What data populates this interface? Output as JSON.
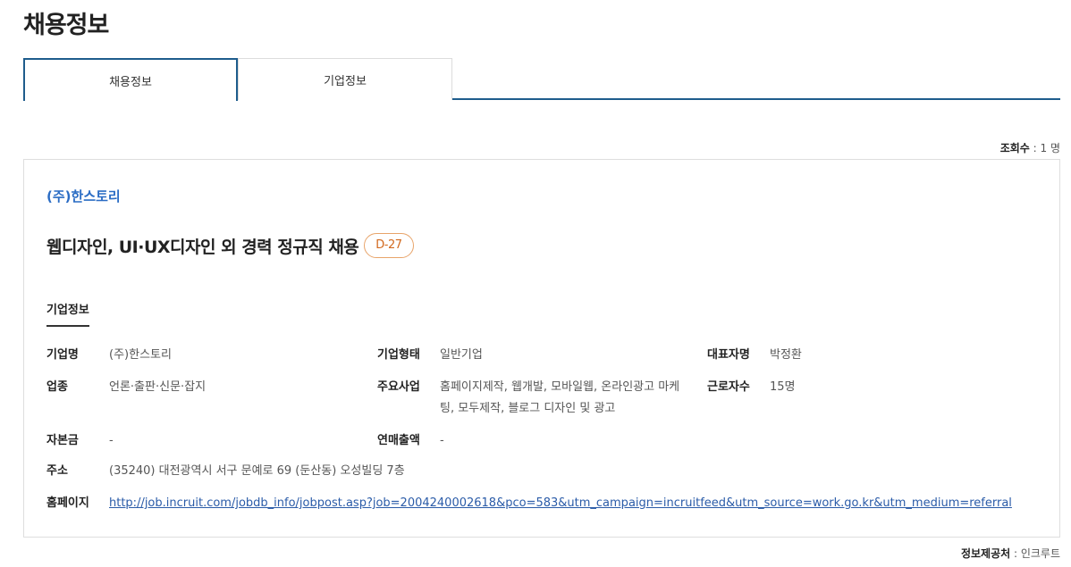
{
  "page": {
    "title": "채용정보"
  },
  "tabs": [
    {
      "label": "채용정보",
      "active": true
    },
    {
      "label": "기업정보",
      "active": false
    }
  ],
  "views": {
    "label": "조회수",
    "separator": " : ",
    "value": "1 명"
  },
  "posting": {
    "company": "(주)한스토리",
    "title": "웹디자인, UI·UX디자인 외 경력 정규직 채용",
    "dday": "D-27"
  },
  "section": {
    "label": "기업정보"
  },
  "company_info": {
    "name": {
      "label": "기업명",
      "value": "(주)한스토리"
    },
    "type": {
      "label": "기업형태",
      "value": "일반기업"
    },
    "ceo": {
      "label": "대표자명",
      "value": "박정환"
    },
    "industry": {
      "label": "업종",
      "value": "언론·출판·신문·잡지"
    },
    "business": {
      "label": "주요사업",
      "line1": "홈페이지제작, 웹개발, 모바일웹, 온라인광고 마케",
      "line2": "팅, 모두제작, 블로그 디자인 및 광고"
    },
    "employees": {
      "label": "근로자수",
      "value": "15명"
    },
    "capital": {
      "label": "자본금",
      "value": "-"
    },
    "revenue": {
      "label": "연매출액",
      "value": "-"
    },
    "address": {
      "label": "주소",
      "value": "(35240) 대전광역시 서구 문예로 69 (둔산동) 오성빌딩 7층"
    },
    "homepage": {
      "label": "홈페이지",
      "value": "http://job.incruit.com/jobdb_info/jobpost.asp?job=2004240002618&pco=583&utm_campaign=incruitfeed&utm_source=work.go.kr&utm_medium=referral"
    }
  },
  "source": {
    "label": "정보제공처",
    "separator": " : ",
    "value": "인크루트"
  },
  "colors": {
    "accent": "#1e5c8c",
    "link": "#2a6cc4",
    "dday": "#d2691e"
  }
}
